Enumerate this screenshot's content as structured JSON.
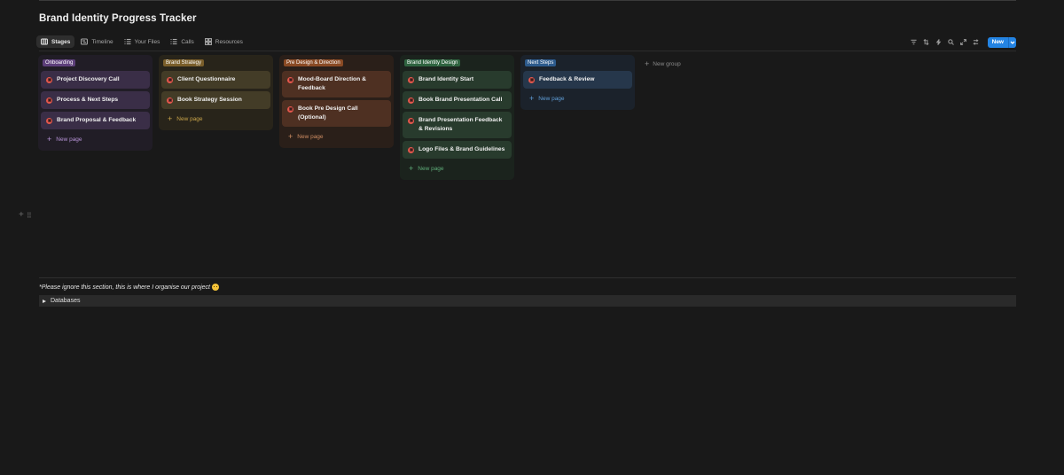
{
  "page": {
    "title": "Brand Identity Progress Tracker"
  },
  "tabs": [
    {
      "label": "Stages",
      "icon": "board-icon",
      "active": true
    },
    {
      "label": "Timeline",
      "icon": "timeline-icon",
      "active": false
    },
    {
      "label": "Your Files",
      "icon": "list-icon",
      "active": false
    },
    {
      "label": "Calls",
      "icon": "list-icon",
      "active": false
    },
    {
      "label": "Resources",
      "icon": "gallery-icon",
      "active": false
    }
  ],
  "toolbar": {
    "icons": [
      "filter-icon",
      "sort-icon",
      "lightning-icon",
      "search-icon",
      "expand-icon",
      "more-icon"
    ],
    "new_label": "New"
  },
  "groups": [
    {
      "name": "Onboarding",
      "color": "#5d3f7a",
      "cards": [
        "Project Discovery Call",
        "Process & Next Steps",
        "Brand Proposal & Feedback"
      ],
      "new_page_label": "New page"
    },
    {
      "name": "Brand Strategy",
      "color": "#7a5e2a",
      "cards": [
        "Client Questionnaire",
        "Book Strategy Session"
      ],
      "new_page_label": "New page"
    },
    {
      "name": "Pre Design & Direction",
      "color": "#8a4a24",
      "cards": [
        "Mood-Board Direction & Feedback",
        "Book Pre Design Call (Optional)"
      ],
      "new_page_label": "New page"
    },
    {
      "name": "Brand Identity Design",
      "color": "#2f6440",
      "cards": [
        "Brand Identity Start",
        "Book Brand Presentation Call",
        "Brand Presentation Feedback & Revisions",
        "Logo Files & Brand Guidelines"
      ],
      "new_page_label": "New page"
    },
    {
      "name": "Next Steps",
      "color": "#2c5a8c",
      "cards": [
        "Feedback & Review"
      ],
      "new_page_label": "New page"
    }
  ],
  "new_group_label": "New group",
  "note": {
    "text": "*Please ignore this section, this is where I organise our project",
    "emoji": "smiley-icon"
  },
  "toggle": {
    "label": "Databases"
  }
}
